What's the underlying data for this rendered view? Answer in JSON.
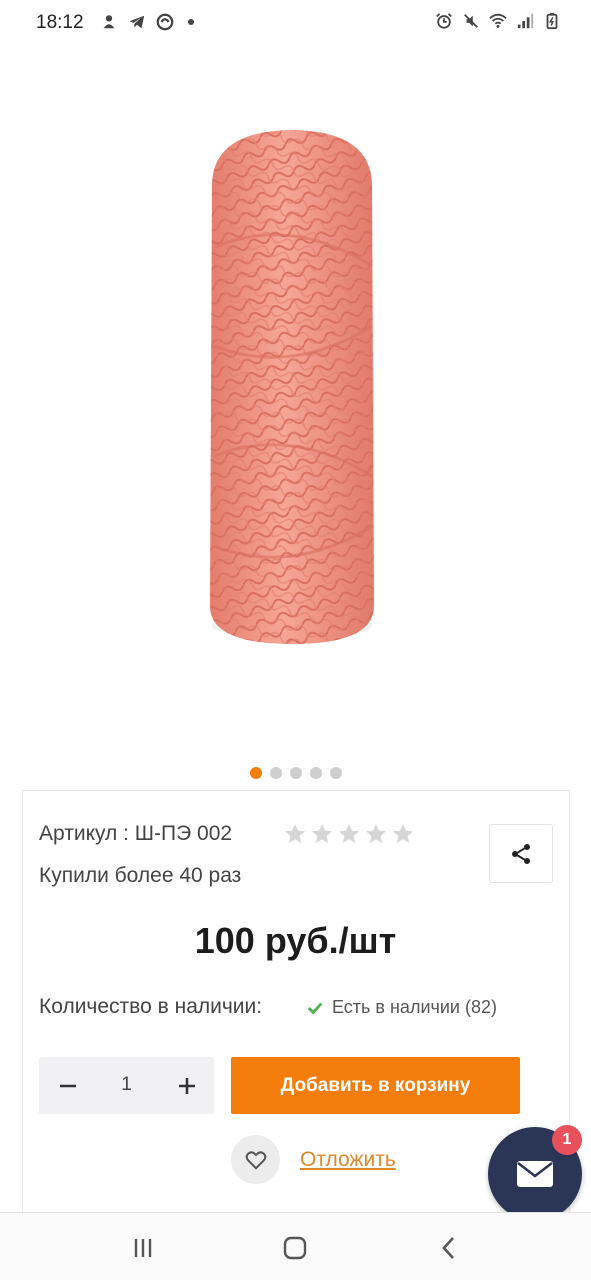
{
  "status_bar": {
    "time": "18:12",
    "left_icons": [
      "notification-icon",
      "telegram-icon",
      "sync-icon"
    ],
    "right_icons": [
      "alarm-icon",
      "mute-icon",
      "wifi-icon",
      "signal-icon",
      "battery-icon"
    ]
  },
  "gallery": {
    "slides_count": 5,
    "active_index": 0,
    "image_alt": "pink-cord-spool-image"
  },
  "product": {
    "sku": "Артикул : Ш-ПЭ 002",
    "rating": 0,
    "rating_max": 5,
    "bought": "Купили более 40 раз",
    "price": "100 руб./шт"
  },
  "stock": {
    "label": "Количество в наличии:",
    "value": "Есть в наличии (82)"
  },
  "quantity": {
    "value": "1"
  },
  "actions": {
    "add_to_cart": "Добавить в корзину",
    "wishlist": "Отложить"
  },
  "chat": {
    "badge": "1"
  },
  "colors": {
    "accent": "#f47d0b",
    "link": "#e0892c",
    "chat_bg": "#2b3556",
    "badge": "#e8505b",
    "check": "#4caf50",
    "cord": "#f29a8a"
  }
}
